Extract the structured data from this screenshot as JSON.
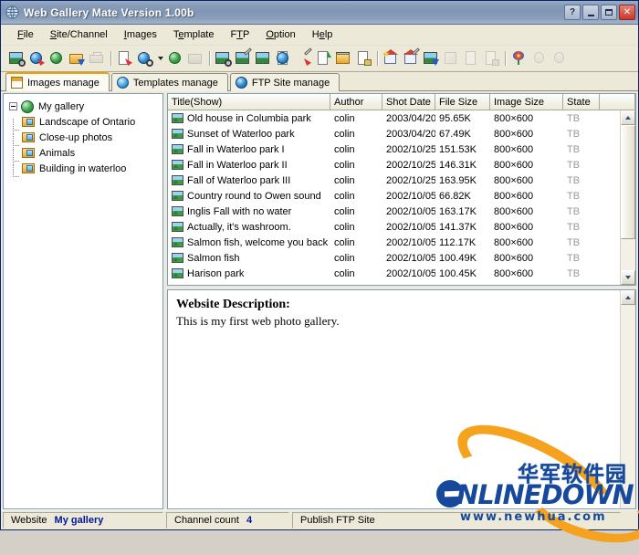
{
  "window": {
    "title": "Web Gallery Mate Version 1.00b",
    "icon": "gallery-globe-icon",
    "buttons": {
      "help": "?",
      "minimize": "minimize-icon",
      "maximize": "maximize-icon",
      "close": "✕"
    }
  },
  "menu": {
    "items": [
      {
        "label": "File",
        "mnemonic": "F"
      },
      {
        "label": "Site/Channel",
        "mnemonic": "S"
      },
      {
        "label": "Images",
        "mnemonic": "I"
      },
      {
        "label": "Template",
        "mnemonic": "e"
      },
      {
        "label": "FTP",
        "mnemonic": "T"
      },
      {
        "label": "Option",
        "mnemonic": "O"
      },
      {
        "label": "Help",
        "mnemonic": "H"
      }
    ]
  },
  "toolbar": {
    "buttons": [
      {
        "name": "new-site-icon",
        "enabled": true
      },
      {
        "name": "open-site-icon",
        "enabled": true
      },
      {
        "name": "browse-web-icon",
        "enabled": true
      },
      {
        "name": "save-site-icon",
        "enabled": true
      },
      {
        "name": "print-icon",
        "enabled": false
      },
      {
        "name": "page-preview-icon",
        "enabled": true
      },
      {
        "name": "find-globe-icon",
        "enabled": true
      },
      {
        "name": "publish-globe-icon",
        "enabled": true
      },
      {
        "name": "folder-gray-icon",
        "enabled": false
      },
      {
        "name": "add-image-icon",
        "enabled": true
      },
      {
        "name": "edit-image-icon",
        "enabled": true
      },
      {
        "name": "image-properties-icon",
        "enabled": true
      },
      {
        "name": "image-page-icon",
        "enabled": true
      },
      {
        "name": "delete-image-icon",
        "enabled": true
      },
      {
        "name": "move-up-icon",
        "enabled": true
      },
      {
        "name": "thumbnail-icon",
        "enabled": true
      },
      {
        "name": "image-list-icon",
        "enabled": true
      },
      {
        "name": "new-template-icon",
        "enabled": true
      },
      {
        "name": "edit-template-icon",
        "enabled": true
      },
      {
        "name": "download-template-icon",
        "enabled": true
      },
      {
        "name": "ftp-upload-icon",
        "enabled": false
      },
      {
        "name": "ftp-file-icon",
        "enabled": false
      },
      {
        "name": "ftp-secure-icon",
        "enabled": false
      },
      {
        "name": "gallery-flower-icon",
        "enabled": true
      },
      {
        "name": "bulb-tip-icon",
        "enabled": false
      },
      {
        "name": "help-about-icon",
        "enabled": false
      }
    ]
  },
  "tabs": [
    {
      "label": "Images manage",
      "icon": "images-manage-icon",
      "active": true
    },
    {
      "label": "Templates manage",
      "icon": "templates-manage-icon",
      "active": false
    },
    {
      "label": "FTP Site manage",
      "icon": "ftp-site-manage-icon",
      "active": false
    }
  ],
  "tree": {
    "root": {
      "label": "My gallery",
      "icon": "site-globe-icon",
      "expanded": true
    },
    "children": [
      {
        "label": "Landscape of Ontario",
        "icon": "channel-folder-icon"
      },
      {
        "label": "Close-up photos",
        "icon": "channel-folder-icon"
      },
      {
        "label": "Animals",
        "icon": "channel-folder-icon"
      },
      {
        "label": "Building in waterloo",
        "icon": "channel-folder-icon"
      }
    ]
  },
  "list": {
    "columns": [
      "Title(Show)",
      "Author",
      "Shot Date",
      "File Size",
      "Image Size",
      "State"
    ],
    "rows": [
      {
        "title": "Old house in Columbia park",
        "author": "colin",
        "date": "2003/04/20",
        "size": "95.65K",
        "dim": "800×600",
        "state": "TB"
      },
      {
        "title": "Sunset of Waterloo park",
        "author": "colin",
        "date": "2003/04/20",
        "size": "67.49K",
        "dim": "800×600",
        "state": "TB"
      },
      {
        "title": "Fall in Waterloo park I",
        "author": "colin",
        "date": "2002/10/25",
        "size": "151.53K",
        "dim": "800×600",
        "state": "TB"
      },
      {
        "title": "Fall in Waterloo park II",
        "author": "colin",
        "date": "2002/10/25",
        "size": "146.31K",
        "dim": "800×600",
        "state": "TB"
      },
      {
        "title": "Fall of Waterloo park III",
        "author": "colin",
        "date": "2002/10/25",
        "size": "163.95K",
        "dim": "800×600",
        "state": "TB"
      },
      {
        "title": "Country round to Owen sound",
        "author": "colin",
        "date": "2002/10/05",
        "size": "66.82K",
        "dim": "800×600",
        "state": "TB"
      },
      {
        "title": "Inglis Fall with no water",
        "author": "colin",
        "date": "2002/10/05",
        "size": "163.17K",
        "dim": "800×600",
        "state": "TB"
      },
      {
        "title": "Actually, it's washroom.",
        "author": "colin",
        "date": "2002/10/05",
        "size": "141.37K",
        "dim": "800×600",
        "state": "TB"
      },
      {
        "title": "Salmon fish, welcome you back",
        "author": "colin",
        "date": "2002/10/05",
        "size": "112.17K",
        "dim": "800×600",
        "state": "TB"
      },
      {
        "title": "Salmon fish",
        "author": "colin",
        "date": "2002/10/05",
        "size": "100.49K",
        "dim": "800×600",
        "state": "TB"
      },
      {
        "title": "Harison park",
        "author": "colin",
        "date": "2002/10/05",
        "size": "100.45K",
        "dim": "800×600",
        "state": "TB"
      }
    ]
  },
  "description": {
    "heading": "Website Description:",
    "text": "This is my first web photo gallery."
  },
  "statusbar": {
    "website_label": "Website",
    "website_value": "My gallery",
    "channel_label": "Channel count",
    "channel_value": "4",
    "publish_label": "Publish FTP Site"
  },
  "watermark": {
    "chinese": "华军软件园",
    "brand": "NLINEDOWN",
    "url": "www.newhua.com"
  },
  "colors": {
    "accent": "#f2a000",
    "title_gradient_start": "#9daec4",
    "title_gradient_end": "#a6b6c9",
    "status_value": "#00179a",
    "watermark_blue": "#16499b",
    "watermark_orange": "#f5a21e"
  }
}
